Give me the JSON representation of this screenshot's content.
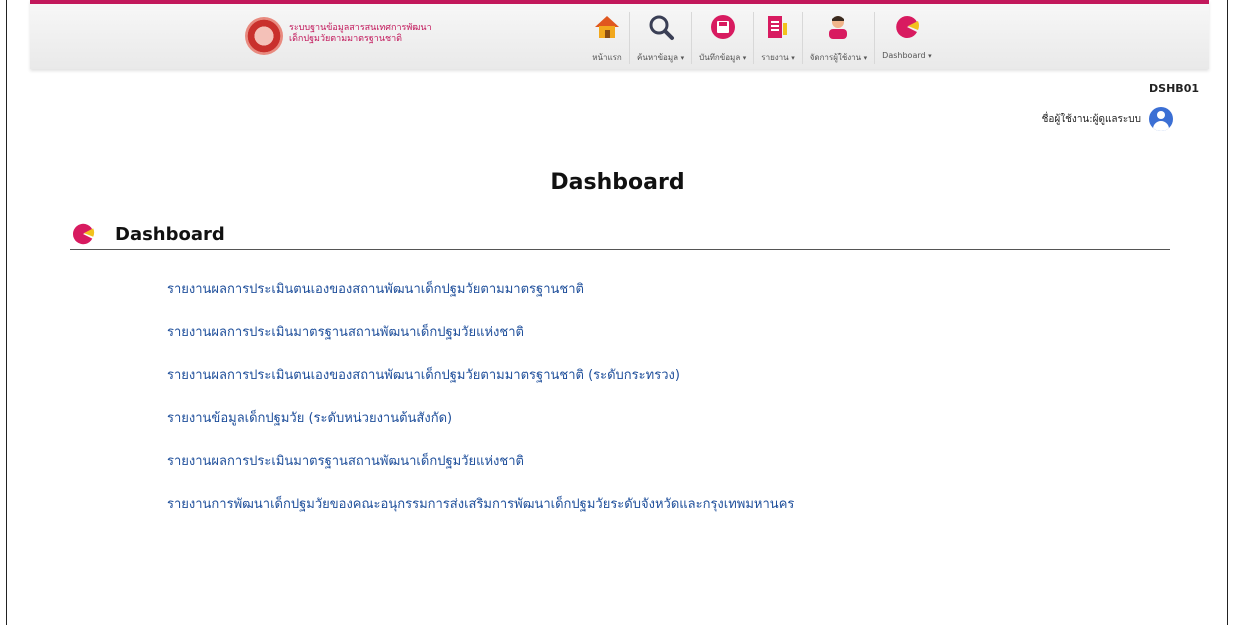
{
  "brand": {
    "line1": "ระบบฐานข้อมูลสารสนเทศการพัฒนา",
    "line2": "เด็กปฐมวัยตามมาตรฐานชาติ"
  },
  "nav": [
    {
      "label": "หน้าแรก",
      "icon": "home-icon",
      "dropdown": false
    },
    {
      "label": "ค้นหาข้อมูล",
      "icon": "search-icon",
      "dropdown": true
    },
    {
      "label": "บันทึกข้อมูล",
      "icon": "save-icon",
      "dropdown": true
    },
    {
      "label": "รายงาน",
      "icon": "report-icon",
      "dropdown": true
    },
    {
      "label": "จัดการผู้ใช้งาน",
      "icon": "user-manage-icon",
      "dropdown": true
    },
    {
      "label": "Dashboard",
      "icon": "pie-chart-icon",
      "dropdown": true
    }
  ],
  "page_code": "DSHB01",
  "user": {
    "name": "ชื่อผู้ใช้งาน:ผู้ดูแลระบบ"
  },
  "page_title": "Dashboard",
  "section": {
    "title": "Dashboard"
  },
  "links": [
    "รายงานผลการประเมินตนเองของสถานพัฒนาเด็กปฐมวัยตามมาตรฐานชาติ",
    "รายงานผลการประเมินมาตรฐานสถานพัฒนาเด็กปฐมวัยแห่งชาติ",
    "รายงานผลการประเมินตนเองของสถานพัฒนาเด็กปฐมวัยตามมาตรฐานชาติ (ระดับกระทรวง)",
    "รายงานข้อมูลเด็กปฐมวัย (ระดับหน่วยงานต้นสังกัด)",
    "รายงานผลการประเมินมาตรฐานสถานพัฒนาเด็กปฐมวัยแห่งชาติ",
    "รายงานการพัฒนาเด็กปฐมวัยของคณะอนุกรรมการส่งเสริมการพัฒนาเด็กปฐมวัยระดับจังหวัดและกรุงเทพมหานคร"
  ],
  "colors": {
    "accent": "#c2185b",
    "link": "#1f4f9b",
    "avatar": "#3b6fd4"
  }
}
